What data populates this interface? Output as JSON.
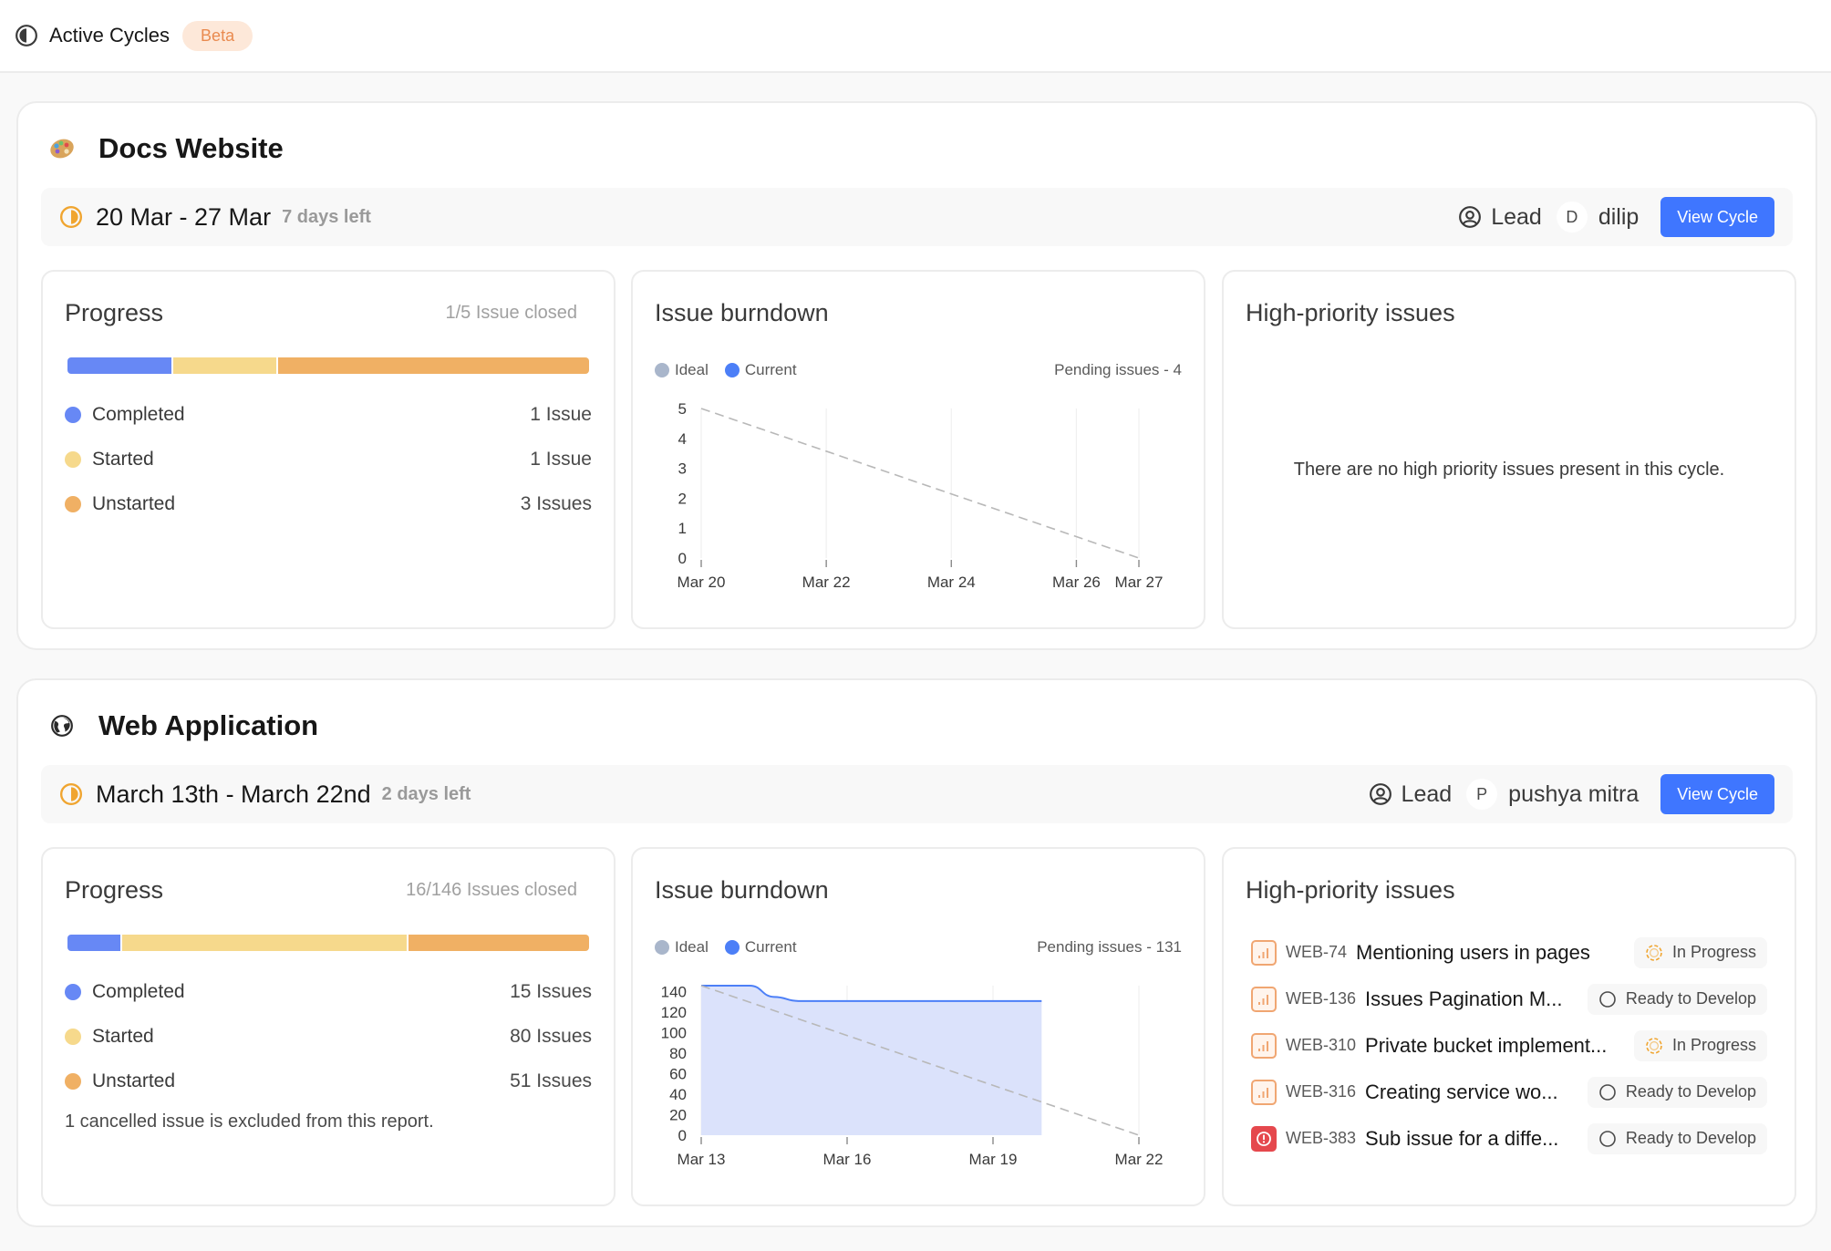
{
  "header": {
    "title": "Active Cycles",
    "badge": "Beta"
  },
  "colors": {
    "completed": "#6788f5",
    "started": "#f6d98c",
    "unstarted": "#f0b064",
    "ideal": "#a9b6cb",
    "current": "#4c7ff7",
    "accent": "#3f76ff",
    "cycle_status": "#f0a530"
  },
  "projects": [
    {
      "name": "Docs Website",
      "emoji": "palette",
      "cycle": {
        "dates": "20 Mar - 27 Mar",
        "days_left": "7 days left",
        "lead_label": "Lead",
        "lead_initial": "D",
        "lead_name": "dilip",
        "view_button": "View Cycle"
      },
      "progress": {
        "title": "Progress",
        "summary": "1/5 Issue closed",
        "rows": [
          {
            "label": "Completed",
            "value": "1 Issue",
            "count": 1
          },
          {
            "label": "Started",
            "value": "1 Issue",
            "count": 1
          },
          {
            "label": "Unstarted",
            "value": "3 Issues",
            "count": 3
          }
        ],
        "note": ""
      },
      "burndown": {
        "title": "Issue burndown",
        "legend_ideal": "Ideal",
        "legend_current": "Current",
        "pending": "Pending issues - 4"
      },
      "high_priority": {
        "title": "High-priority issues",
        "empty_message": "There are no high priority issues present in this cycle.",
        "issues": []
      }
    },
    {
      "name": "Web Application",
      "emoji": "globe",
      "cycle": {
        "dates": "March 13th - March 22nd",
        "days_left": "2 days left",
        "lead_label": "Lead",
        "lead_initial": "P",
        "lead_name": "pushya mitra",
        "view_button": "View Cycle"
      },
      "progress": {
        "title": "Progress",
        "summary": "16/146 Issues closed",
        "rows": [
          {
            "label": "Completed",
            "value": "15 Issues",
            "count": 15
          },
          {
            "label": "Started",
            "value": "80 Issues",
            "count": 80
          },
          {
            "label": "Unstarted",
            "value": "51 Issues",
            "count": 51
          }
        ],
        "note": "1 cancelled issue is excluded from this report."
      },
      "burndown": {
        "title": "Issue burndown",
        "legend_ideal": "Ideal",
        "legend_current": "Current",
        "pending": "Pending issues - 131"
      },
      "high_priority": {
        "title": "High-priority issues",
        "empty_message": "",
        "issues": [
          {
            "id": "WEB-74",
            "title": "Mentioning users in pages",
            "priority": "high",
            "state": "In Progress",
            "state_type": "in-progress"
          },
          {
            "id": "WEB-136",
            "title": "Issues Pagination M...",
            "priority": "high",
            "state": "Ready to Develop",
            "state_type": "ready"
          },
          {
            "id": "WEB-310",
            "title": "Private bucket implement...",
            "priority": "high",
            "state": "In Progress",
            "state_type": "in-progress"
          },
          {
            "id": "WEB-316",
            "title": "Creating service wo...",
            "priority": "high",
            "state": "Ready to Develop",
            "state_type": "ready"
          },
          {
            "id": "WEB-383",
            "title": "Sub issue for a diffe...",
            "priority": "urgent",
            "state": "Ready to Develop",
            "state_type": "ready"
          }
        ]
      }
    }
  ],
  "chart_data": [
    {
      "type": "line",
      "title": "Issue burndown",
      "series": [
        {
          "name": "Ideal",
          "style": "dashed",
          "x": [
            "Mar 20",
            "Mar 27"
          ],
          "values": [
            5,
            0
          ]
        },
        {
          "name": "Current",
          "style": "area",
          "x": [],
          "values": []
        }
      ],
      "x_ticks": [
        "Mar 20",
        "Mar 22",
        "Mar 24",
        "Mar 26",
        "Mar 27"
      ],
      "x_days": [
        0,
        2,
        4,
        6,
        7
      ],
      "y_ticks": [
        0,
        1,
        2,
        3,
        4,
        5
      ],
      "ylim": [
        0,
        5
      ],
      "xlim_days": [
        0,
        7
      ],
      "grid": "vertical"
    },
    {
      "type": "area",
      "title": "Issue burndown",
      "series": [
        {
          "name": "Ideal",
          "style": "dashed",
          "x_days": [
            0,
            9
          ],
          "values": [
            146,
            0
          ]
        },
        {
          "name": "Current",
          "style": "area",
          "x_days": [
            0,
            1,
            1.5,
            2,
            7
          ],
          "values": [
            146,
            146,
            135,
            131,
            131
          ]
        }
      ],
      "x_ticks": [
        "Mar 13",
        "Mar 16",
        "Mar 19",
        "Mar 22"
      ],
      "x_days": [
        0,
        3,
        6,
        9
      ],
      "y_ticks": [
        0,
        20,
        40,
        60,
        80,
        100,
        120,
        140
      ],
      "ylim": [
        0,
        146
      ],
      "xlim_days": [
        0,
        9
      ],
      "grid": "vertical"
    }
  ]
}
